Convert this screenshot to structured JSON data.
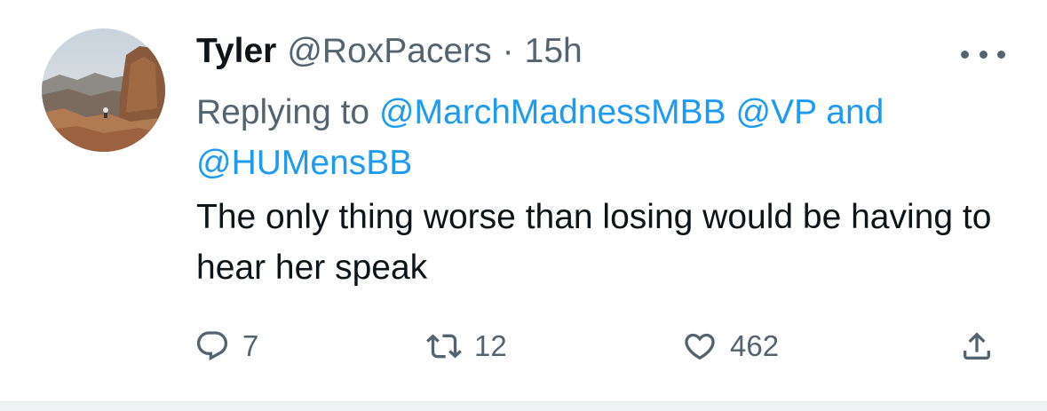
{
  "tweet": {
    "author_name": "Tyler",
    "handle": "@RoxPacers",
    "separator": "·",
    "time": "15h",
    "replying_prefix": "Replying to",
    "mention_1": "@MarchMadnessMBB",
    "mention_2": "@VP",
    "mention_joiner": "and",
    "mention_3": "@HUMensBB",
    "text": "The only thing worse than losing would be having to hear her speak"
  },
  "actions": {
    "reply_count": "7",
    "retweet_count": "12",
    "like_count": "462"
  },
  "icons": {
    "more": "more-horizontal-icon",
    "reply": "reply-bubble-icon",
    "retweet": "retweet-icon",
    "like": "heart-icon",
    "share": "share-upload-icon"
  },
  "colors": {
    "text": "#0f1419",
    "secondary": "#536471",
    "link": "#1d9bf0",
    "divider": "#eff3f4"
  }
}
